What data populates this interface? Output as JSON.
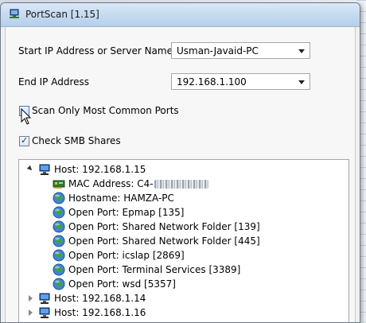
{
  "window": {
    "title": "PortScan [1.15]"
  },
  "form": {
    "start_label": "Start IP Address or Server Name",
    "start_value": "Usman-Javaid-PC",
    "end_label": "End IP Address",
    "end_value": "192.168.1.100",
    "common_ports_label": "Scan Only Most Common Ports",
    "common_ports_checked": false,
    "smb_label": "Check SMB Shares",
    "smb_checked": true,
    "check_mark": "✓"
  },
  "tree": {
    "hosts": [
      {
        "label": "Host: 192.168.1.15",
        "expanded": true,
        "children": [
          {
            "icon": "network-card-icon",
            "label": "MAC Address: C4-"
          },
          {
            "icon": "globe-icon",
            "label": "Hostname: HAMZA-PC"
          },
          {
            "icon": "globe-icon",
            "label": "Open Port: Epmap [135]"
          },
          {
            "icon": "globe-icon",
            "label": "Open Port: Shared Network Folder [139]"
          },
          {
            "icon": "globe-icon",
            "label": "Open Port: Shared Network Folder [445]"
          },
          {
            "icon": "globe-icon",
            "label": "Open Port: icslap [2869]"
          },
          {
            "icon": "globe-icon",
            "label": "Open Port: Terminal Services [3389]"
          },
          {
            "icon": "globe-icon",
            "label": "Open Port: wsd [5357]"
          }
        ]
      },
      {
        "label": "Host: 192.168.1.14",
        "expanded": false
      },
      {
        "label": "Host: 192.168.1.16",
        "expanded": false
      }
    ]
  }
}
